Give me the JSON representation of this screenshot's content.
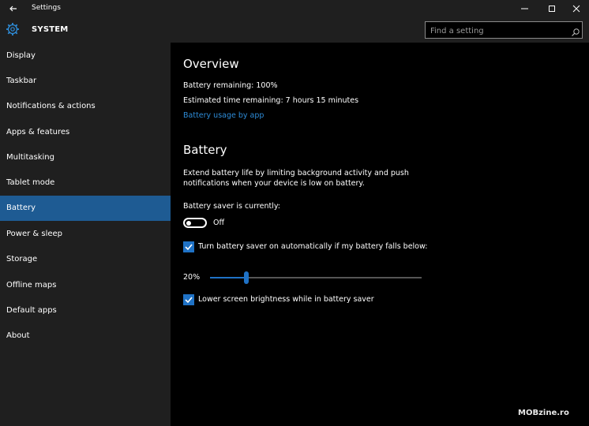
{
  "window": {
    "title": "Settings",
    "back_icon": "back-arrow-icon",
    "controls": [
      "minimize-icon",
      "maximize-icon",
      "close-icon"
    ]
  },
  "header": {
    "icon": "gear-icon",
    "title": "SYSTEM",
    "search_placeholder": "Find a setting",
    "search_icon": "search-icon"
  },
  "sidebar": {
    "items": [
      {
        "label": "Display"
      },
      {
        "label": "Taskbar"
      },
      {
        "label": "Notifications & actions"
      },
      {
        "label": "Apps & features"
      },
      {
        "label": "Multitasking"
      },
      {
        "label": "Tablet mode"
      },
      {
        "label": "Battery",
        "active": true
      },
      {
        "label": "Power & sleep"
      },
      {
        "label": "Storage"
      },
      {
        "label": "Offline maps"
      },
      {
        "label": "Default apps"
      },
      {
        "label": "About"
      }
    ]
  },
  "overview": {
    "heading": "Overview",
    "battery_remaining": "Battery remaining: 100%",
    "time_remaining": "Estimated time remaining: 7 hours 15 minutes",
    "usage_link": "Battery usage by app"
  },
  "battery": {
    "heading": "Battery",
    "description": "Extend battery life by limiting background activity and push notifications when your device is low on battery.",
    "saver_label": "Battery saver is currently:",
    "saver_state": "Off",
    "saver_on": false,
    "auto_on_label": "Turn battery saver on automatically if my battery falls below:",
    "auto_on_checked": true,
    "threshold_text": "20%",
    "threshold_fraction": 0.17,
    "brightness_label": "Lower screen brightness while in battery saver",
    "brightness_checked": true
  },
  "colors": {
    "accent": "#1f72c6",
    "active_nav": "#1e5b93",
    "link": "#2e8cd8",
    "chrome": "#1f1f1f",
    "content_bg": "#000000"
  },
  "watermark": "MOBzine.ro"
}
